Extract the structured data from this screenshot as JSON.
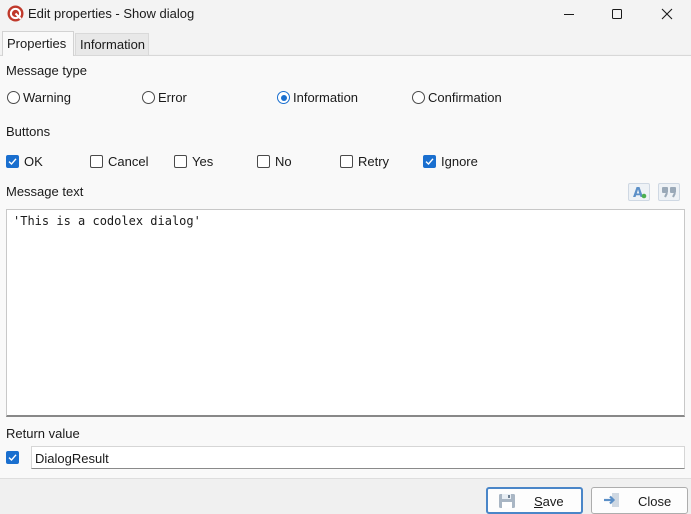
{
  "window": {
    "title": "Edit properties - Show dialog",
    "app_icon": "codolex-logo-icon",
    "controls": {
      "minimize": "minimize-icon",
      "maximize": "maximize-icon",
      "close": "close-icon"
    }
  },
  "tabs": [
    {
      "label": "Properties",
      "active": true
    },
    {
      "label": "Information",
      "active": false
    }
  ],
  "message_type": {
    "label": "Message type",
    "options": [
      {
        "label": "Warning",
        "selected": false
      },
      {
        "label": "Error",
        "selected": false
      },
      {
        "label": "Information",
        "selected": true
      },
      {
        "label": "Confirmation",
        "selected": false
      }
    ]
  },
  "buttons": {
    "label": "Buttons",
    "options": [
      {
        "label": "OK",
        "checked": true
      },
      {
        "label": "Cancel",
        "checked": false
      },
      {
        "label": "Yes",
        "checked": false
      },
      {
        "label": "No",
        "checked": false
      },
      {
        "label": "Retry",
        "checked": false
      },
      {
        "label": "Ignore",
        "checked": true
      }
    ]
  },
  "message_text": {
    "label": "Message text",
    "value": "'This is a codolex dialog'",
    "tools": [
      "expression-editor-icon",
      "quote-icon"
    ]
  },
  "return_value": {
    "label": "Return value",
    "enabled": true,
    "value": "DialogResult"
  },
  "footer": {
    "save_label": "Save",
    "close_label": "Close",
    "save_icon": "floppy-disk-icon",
    "close_icon": "exit-arrow-icon"
  },
  "colors": {
    "accent": "#1a6fcf",
    "title_icon": "#c0392b"
  }
}
